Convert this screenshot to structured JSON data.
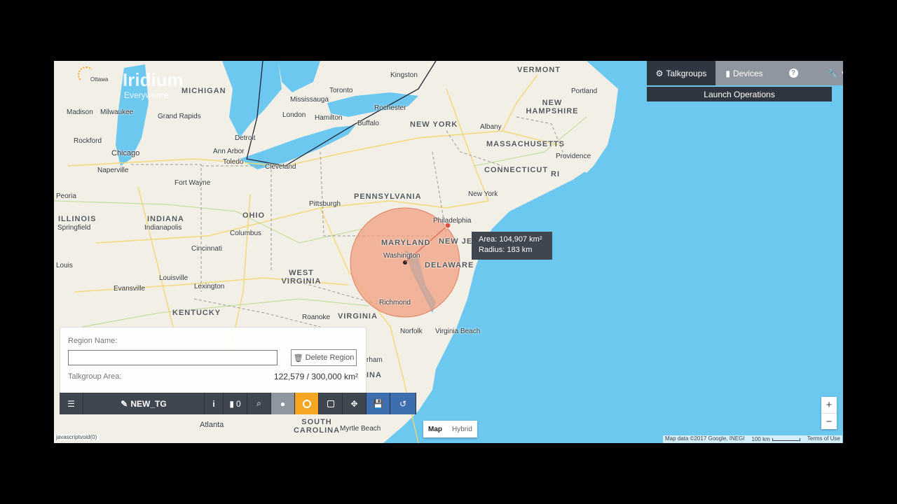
{
  "logo": {
    "name": "Iridium",
    "tagline": "Everywhere"
  },
  "nav": {
    "talkgroups_label": "Talkgroups",
    "devices_label": "Devices",
    "help_icon": "question-circle-icon",
    "tools_icon": "wrench-icon",
    "launch_label": "Launch Operations"
  },
  "region_panel": {
    "name_label": "Region Name:",
    "name_value": "",
    "delete_label": "Delete Region",
    "area_label": "Talkgroup Area:",
    "area_value": "122,579 / 300,000 km²"
  },
  "toolbar": {
    "tg_name": "NEW_TG",
    "device_count": "0"
  },
  "tooltip": {
    "area": "Area: 104,907 km²",
    "radius": "Radius: 183 km"
  },
  "map_type": {
    "map": "Map",
    "hybrid": "Hybrid"
  },
  "zoom": {
    "in": "+",
    "out": "−"
  },
  "footer": {
    "data": "Map data ©2017 Google, INEGI",
    "scale": "100 km",
    "terms": "Terms of Use"
  },
  "status": "javascriptvoid(0)",
  "map_labels": {
    "states": [
      "MICHIGAN",
      "VERMONT",
      "NEW HAMPSHIRE",
      "NEW YORK",
      "MASSACHUSETTS",
      "CONNECTICUT",
      "RI",
      "PENNSYLVANIA",
      "OHIO",
      "INDIANA",
      "ILLINOIS",
      "MARYLAND",
      "NEW JE",
      "DELAWARE",
      "WEST VIRGINIA",
      "KENTUCKY",
      "VIRGINIA",
      "SOUTH CAROLINA",
      "INA"
    ],
    "cities": [
      "Kingston",
      "Portland",
      "Toronto",
      "Mississauga",
      "Rochester",
      "Hamilton",
      "Buffalo",
      "London",
      "Albany",
      "Madison",
      "Milwaukee",
      "Grand Rapids",
      "Detroit",
      "Ann Arbor",
      "Toledo",
      "Cleveland",
      "Rockford",
      "Chicago",
      "Naperville",
      "Providence",
      "Fort Wayne",
      "New York",
      "Pittsburgh",
      "Peoria",
      "Springfield",
      "Indianapolis",
      "Columbus",
      "Philadelphia",
      "Washington",
      "Cincinnati",
      "Louis",
      "Louisville",
      "Lexington",
      "Evansville",
      "Richmond",
      "Roanoke",
      "Norfolk",
      "Virginia Beach",
      "Atlanta",
      "Myrtle Beach",
      "rham",
      "Ottawa"
    ]
  },
  "colors": {
    "water": "#6dc8f0",
    "land": "#f1efe6",
    "circle": "#f0a080",
    "toolbar": "#3f4650",
    "active_orange": "#f5a623",
    "blue_btn": "#3d6fb0"
  }
}
